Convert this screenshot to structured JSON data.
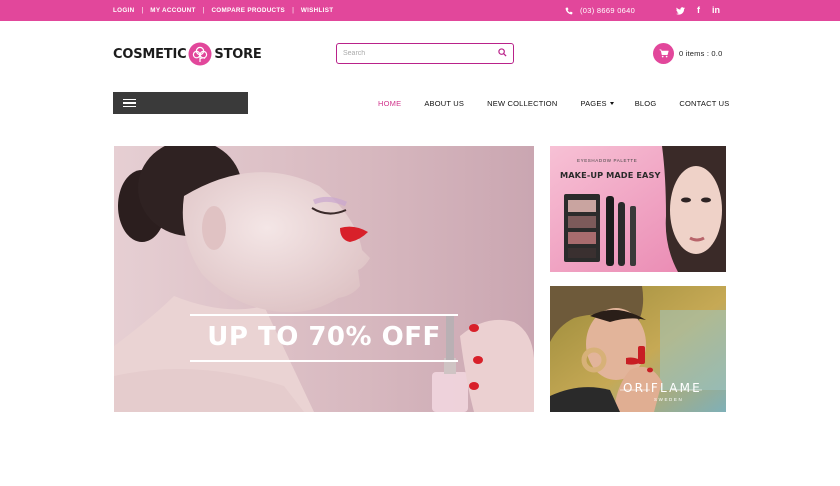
{
  "topbar": {
    "links": [
      {
        "label": "LOGIN"
      },
      {
        "label": "MY ACCOUNT"
      },
      {
        "label": "COMPARE PRODUCTS"
      },
      {
        "label": "WISHLIST"
      }
    ],
    "separator": "|",
    "phone": "(03) 8669 0640",
    "social": {
      "twitter": "t",
      "facebook": "f",
      "linkedin": "in"
    }
  },
  "header": {
    "logo_left": "COSMETIC",
    "logo_right": "STORE",
    "search_placeholder": "Search",
    "cart_text": "0 items : 0.0"
  },
  "nav": {
    "items": [
      {
        "label": "HOME"
      },
      {
        "label": "ABOUT US"
      },
      {
        "label": "NEW COLLECTION"
      },
      {
        "label": "PAGES"
      },
      {
        "label": "BLOG"
      },
      {
        "label": "CONTACT US"
      }
    ]
  },
  "banners": {
    "hero_text": "UP TO 70% OFF",
    "side_one_kicker": "EYESHADOW PALETTE",
    "side_one_headline": "MAKE-UP MADE EASY",
    "side_two_brand": "ORIFLAME",
    "side_two_sub": "SWEDEN"
  },
  "colors": {
    "brand_pink": "#e2479b",
    "search_border": "#b9228a",
    "nav_active": "#d1358d",
    "category_bar": "#3a3a3a"
  }
}
